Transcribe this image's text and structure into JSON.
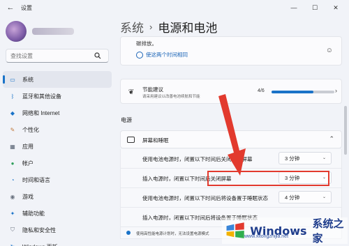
{
  "window": {
    "title": "设置",
    "back_glyph": "←",
    "min_glyph": "—",
    "max_glyph": "☐",
    "close_glyph": "✕"
  },
  "search": {
    "placeholder": "查找设置"
  },
  "sidebar": {
    "items": [
      {
        "label": "系统",
        "icon": "monitor-icon",
        "color": "#1a73c8",
        "active": true
      },
      {
        "label": "蓝牙和其他设备",
        "icon": "bluetooth-icon",
        "color": "#1a73c8"
      },
      {
        "label": "网络和 Internet",
        "icon": "wifi-icon",
        "color": "#1a73c8"
      },
      {
        "label": "个性化",
        "icon": "brush-icon",
        "color": "#c0773a"
      },
      {
        "label": "应用",
        "icon": "apps-icon",
        "color": "#556070"
      },
      {
        "label": "帐户",
        "icon": "account-icon",
        "color": "#2e9e5a"
      },
      {
        "label": "时间和语言",
        "icon": "globe-clock-icon",
        "color": "#1a73c8"
      },
      {
        "label": "游戏",
        "icon": "gamepad-icon",
        "color": "#6b7380"
      },
      {
        "label": "辅助功能",
        "icon": "accessibility-icon",
        "color": "#1a73c8"
      },
      {
        "label": "隐私和安全性",
        "icon": "shield-icon",
        "color": "#6b7380"
      },
      {
        "label": "Windows 更新",
        "icon": "update-icon",
        "color": "#1a73c8"
      }
    ]
  },
  "breadcrumb": {
    "parent": "系统",
    "separator": "›",
    "current": "电源和电池"
  },
  "top_card": {
    "line1": "碳排放。",
    "link": "使这两个时间相同"
  },
  "suggestion": {
    "title": "节能建议",
    "subtitle": "请采用建议以改善电池续航和节能",
    "count": "4/6",
    "progress": 0.667
  },
  "power_section": {
    "title": "电源",
    "screen_sleep": {
      "title": "屏幕和睡眠"
    },
    "rows": [
      {
        "label": "使用电池电源时，闭置以下时间后关闭我的屏幕",
        "value": "3 分钟"
      },
      {
        "label": "插入电源时，闭置以下时间后关闭屏幕",
        "value": "3 分钟"
      },
      {
        "label": "使用电池电源时，闭置以下时间后将设备置于睡眠状态",
        "value": "4 分钟"
      },
      {
        "label": "插入电源时，闭置以下时间后将设备置于睡眠状态",
        "value": ""
      }
    ]
  },
  "bottom_notice": "使用高性能电源计划时，无法设置电源模式",
  "watermark": {
    "brand": "Windows",
    "text": "系统之家",
    "url": "www.xitongzhijia.net"
  },
  "colors": {
    "accent": "#1a73c8",
    "highlight": "#e23a2e",
    "arrow": "#e23a2e"
  }
}
